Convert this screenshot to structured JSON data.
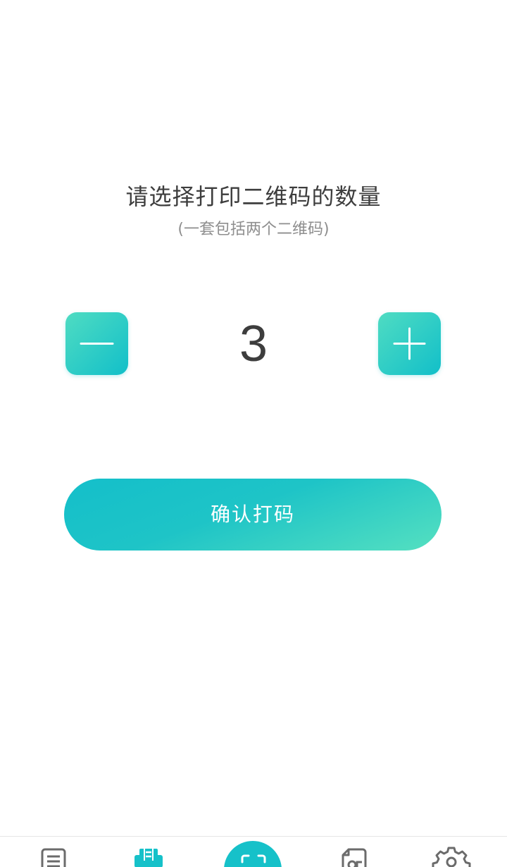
{
  "header": {
    "title": "请选择打印二维码的数量",
    "subtitle": "(一套包括两个二维码)"
  },
  "stepper": {
    "value": "3",
    "decrement_icon": "minus-icon",
    "increment_icon": "plus-icon"
  },
  "confirm": {
    "label": "确认打码"
  },
  "tabbar": {
    "items": [
      {
        "icon": "list-icon"
      },
      {
        "icon": "printer-icon"
      },
      {
        "icon": "scan-icon"
      },
      {
        "icon": "document-icon"
      },
      {
        "icon": "gear-icon"
      }
    ]
  },
  "colors": {
    "accent": "#16c1c9",
    "accent_light": "#4fdcc2",
    "text_primary": "#3d3d3d",
    "text_secondary": "#8e8e8e"
  }
}
